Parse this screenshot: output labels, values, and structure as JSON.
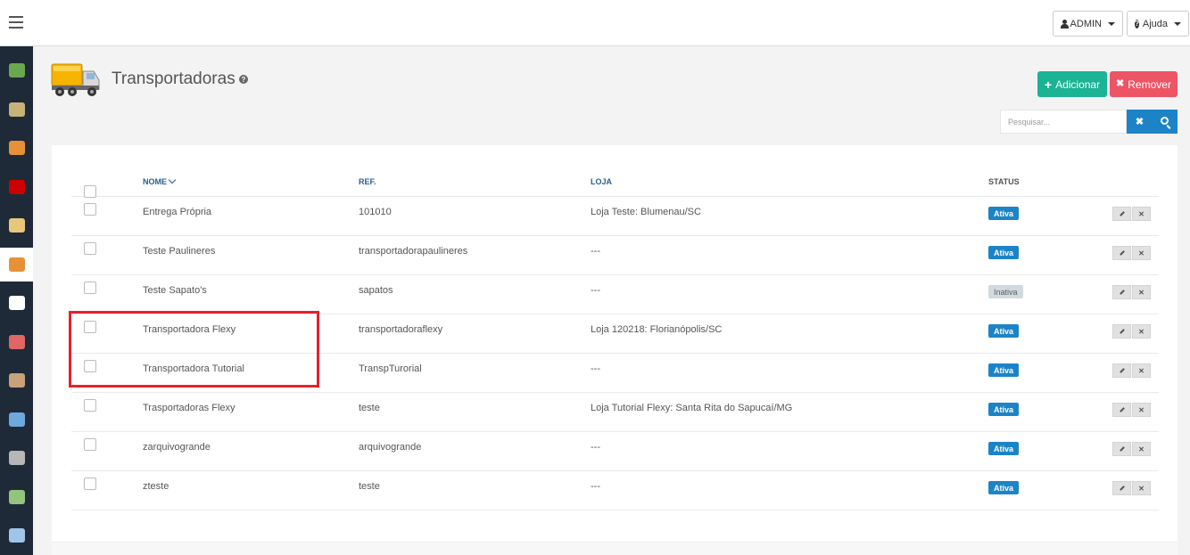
{
  "topbar": {
    "admin_label": "ADMIN",
    "help_label": "Ajuda"
  },
  "sidebar": {
    "items": [
      {
        "icon": "bag-icon",
        "color": "#6aa84f",
        "active": false
      },
      {
        "icon": "product-icon",
        "color": "#c9b27a",
        "active": false
      },
      {
        "icon": "box-icon",
        "color": "#e69138",
        "active": false
      },
      {
        "icon": "discount-icon",
        "color": "#cc0000",
        "active": false
      },
      {
        "icon": "card-icon",
        "color": "#e8c77a",
        "active": false
      },
      {
        "icon": "truck-icon",
        "color": "#e69138",
        "active": true
      },
      {
        "icon": "document-icon",
        "color": "#ffffff",
        "active": false
      },
      {
        "icon": "customers-icon",
        "color": "#e06666",
        "active": false
      },
      {
        "icon": "user-icon",
        "color": "#c9a27a",
        "active": false
      },
      {
        "icon": "image-icon",
        "color": "#6fa8dc",
        "active": false
      },
      {
        "icon": "server-icon",
        "color": "#b7b7b7",
        "active": false
      },
      {
        "icon": "chart-icon",
        "color": "#93c47d",
        "active": false
      },
      {
        "icon": "gallery-icon",
        "color": "#9fc5e8",
        "active": false
      }
    ]
  },
  "page": {
    "title": "Transportadoras",
    "add_label": "Adicionar",
    "remove_label": "Remover",
    "search_placeholder": "Pesquisar..."
  },
  "table": {
    "headers": {
      "nome": "NOME",
      "ref": "REF.",
      "loja": "LOJA",
      "status": "STATUS"
    },
    "rows": [
      {
        "nome": "Entrega Própria",
        "ref": "101010",
        "loja": "Loja Teste: Blumenau/SC",
        "status": "Ativa",
        "active": true
      },
      {
        "nome": "Teste Paulineres",
        "ref": "transportadorapaulineres",
        "loja": "---",
        "status": "Ativa",
        "active": true
      },
      {
        "nome": "Teste Sapato's",
        "ref": "sapatos",
        "loja": "---",
        "status": "Inativa",
        "active": false
      },
      {
        "nome": "Transportadora Flexy",
        "ref": "transportadoraflexy",
        "loja": "Loja 120218: Florianópolis/SC",
        "status": "Ativa",
        "active": true
      },
      {
        "nome": "Transportadora Tutorial",
        "ref": "TranspTurorial",
        "loja": "---",
        "status": "Ativa",
        "active": true
      },
      {
        "nome": "Trasportadoras Flexy",
        "ref": "teste",
        "loja": "Loja Tutorial Flexy: Santa Rita do Sapucaí/MG",
        "status": "Ativa",
        "active": true
      },
      {
        "nome": "zarquivogrande",
        "ref": "arquivogrande",
        "loja": "---",
        "status": "Ativa",
        "active": true
      },
      {
        "nome": "zteste",
        "ref": "teste",
        "loja": "---",
        "status": "Ativa",
        "active": true
      }
    ]
  },
  "colors": {
    "add": "#1ab394",
    "remove": "#ed5565",
    "search": "#1c84c6",
    "highlight": "#e8202a"
  }
}
